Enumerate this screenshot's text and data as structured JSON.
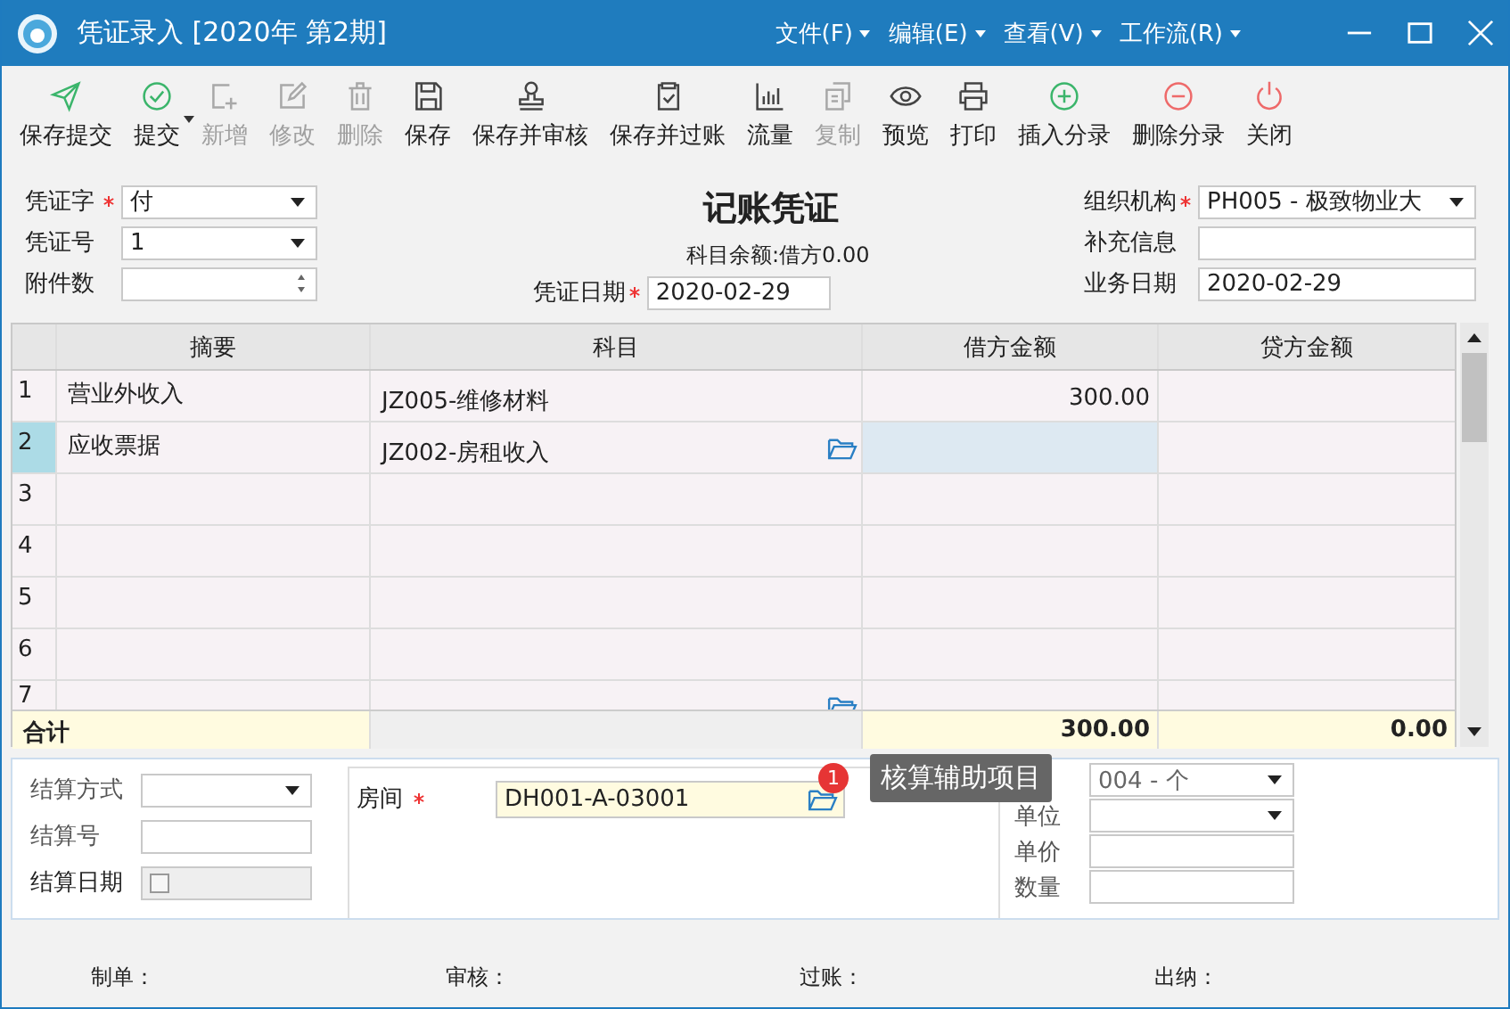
{
  "window": {
    "title": "凭证录入 [2020年 第2期]",
    "menus": [
      "文件(F)",
      "编辑(E)",
      "查看(V)",
      "工作流(R)"
    ]
  },
  "toolbar": [
    {
      "label": "保存提交",
      "kind": "send",
      "disabled": false,
      "dropdown": false
    },
    {
      "label": "提交",
      "kind": "check",
      "disabled": false,
      "dropdown": true
    },
    {
      "label": "新增",
      "kind": "new",
      "disabled": true,
      "dropdown": false
    },
    {
      "label": "修改",
      "kind": "edit",
      "disabled": true,
      "dropdown": false
    },
    {
      "label": "删除",
      "kind": "trash",
      "disabled": true,
      "dropdown": false
    },
    {
      "label": "保存",
      "kind": "save",
      "disabled": false,
      "dropdown": false
    },
    {
      "label": "保存并审核",
      "kind": "stamp",
      "disabled": false,
      "dropdown": false
    },
    {
      "label": "保存并过账",
      "kind": "clipboard",
      "disabled": false,
      "dropdown": false
    },
    {
      "label": "流量",
      "kind": "chart",
      "disabled": false,
      "dropdown": false
    },
    {
      "label": "复制",
      "kind": "copy",
      "disabled": true,
      "dropdown": false
    },
    {
      "label": "预览",
      "kind": "eye",
      "disabled": false,
      "dropdown": false
    },
    {
      "label": "打印",
      "kind": "printer",
      "disabled": false,
      "dropdown": false
    },
    {
      "label": "插入分录",
      "kind": "plus",
      "disabled": false,
      "dropdown": false
    },
    {
      "label": "删除分录",
      "kind": "minus",
      "disabled": false,
      "dropdown": false
    },
    {
      "label": "关闭",
      "kind": "power",
      "disabled": false,
      "dropdown": false
    }
  ],
  "header": {
    "title": "记账凭证",
    "balance": "科目余额:借方0.00",
    "left": [
      {
        "label": "凭证字",
        "required": true,
        "kind": "select",
        "value": "付"
      },
      {
        "label": "凭证号",
        "required": false,
        "kind": "select",
        "value": "1"
      },
      {
        "label": "附件数",
        "required": false,
        "kind": "spinner"
      }
    ],
    "date": {
      "label": "凭证日期",
      "required": true,
      "value": "2020-02-29"
    },
    "right": [
      {
        "label": "组织机构",
        "required": true,
        "kind": "select",
        "value": "PH005 - 极致物业大"
      },
      {
        "label": "补充信息",
        "required": false,
        "kind": "input"
      },
      {
        "label": "业务日期",
        "required": false,
        "kind": "input",
        "value": "2020-02-29"
      }
    ]
  },
  "grid": {
    "columns": [
      "摘要",
      "科目",
      "借方金额",
      "贷方金额"
    ],
    "rows": [
      {
        "no": "1",
        "summary": "营业外收入",
        "account": "JZ005-维修材料",
        "debit": "300.00",
        "selected": false,
        "lookup": false
      },
      {
        "no": "2",
        "summary": "应收票据",
        "account": "JZ002-房租收入",
        "selected": true,
        "lookup": true
      },
      {
        "no": "3",
        "selected": false,
        "lookup": false
      },
      {
        "no": "4",
        "selected": false,
        "lookup": false
      },
      {
        "no": "5",
        "selected": false,
        "lookup": false
      },
      {
        "no": "6",
        "selected": false,
        "lookup": false
      },
      {
        "no": "7",
        "selected": false,
        "lookup": true
      }
    ],
    "total": {
      "label": "合计",
      "debit": "300.00",
      "credit": "0.00"
    }
  },
  "detail": {
    "left": [
      {
        "label": "结算方式",
        "kind": "select"
      },
      {
        "label": "结算号",
        "kind": "input"
      },
      {
        "label": "结算日期",
        "kind": "checkbox",
        "checked": false
      }
    ],
    "room": {
      "label": "房间",
      "required": true,
      "value": "DH001-A-03001"
    },
    "badge": "1",
    "tooltip": "核算辅助项目",
    "right": [
      {
        "kind": "select",
        "value": "004 - 个"
      },
      {
        "label": "单位",
        "kind": "select"
      },
      {
        "label": "单价",
        "kind": "input"
      },
      {
        "label": "数量",
        "kind": "input"
      }
    ]
  },
  "footer": [
    "制单：",
    "审核：",
    "过账：",
    "出纳："
  ]
}
